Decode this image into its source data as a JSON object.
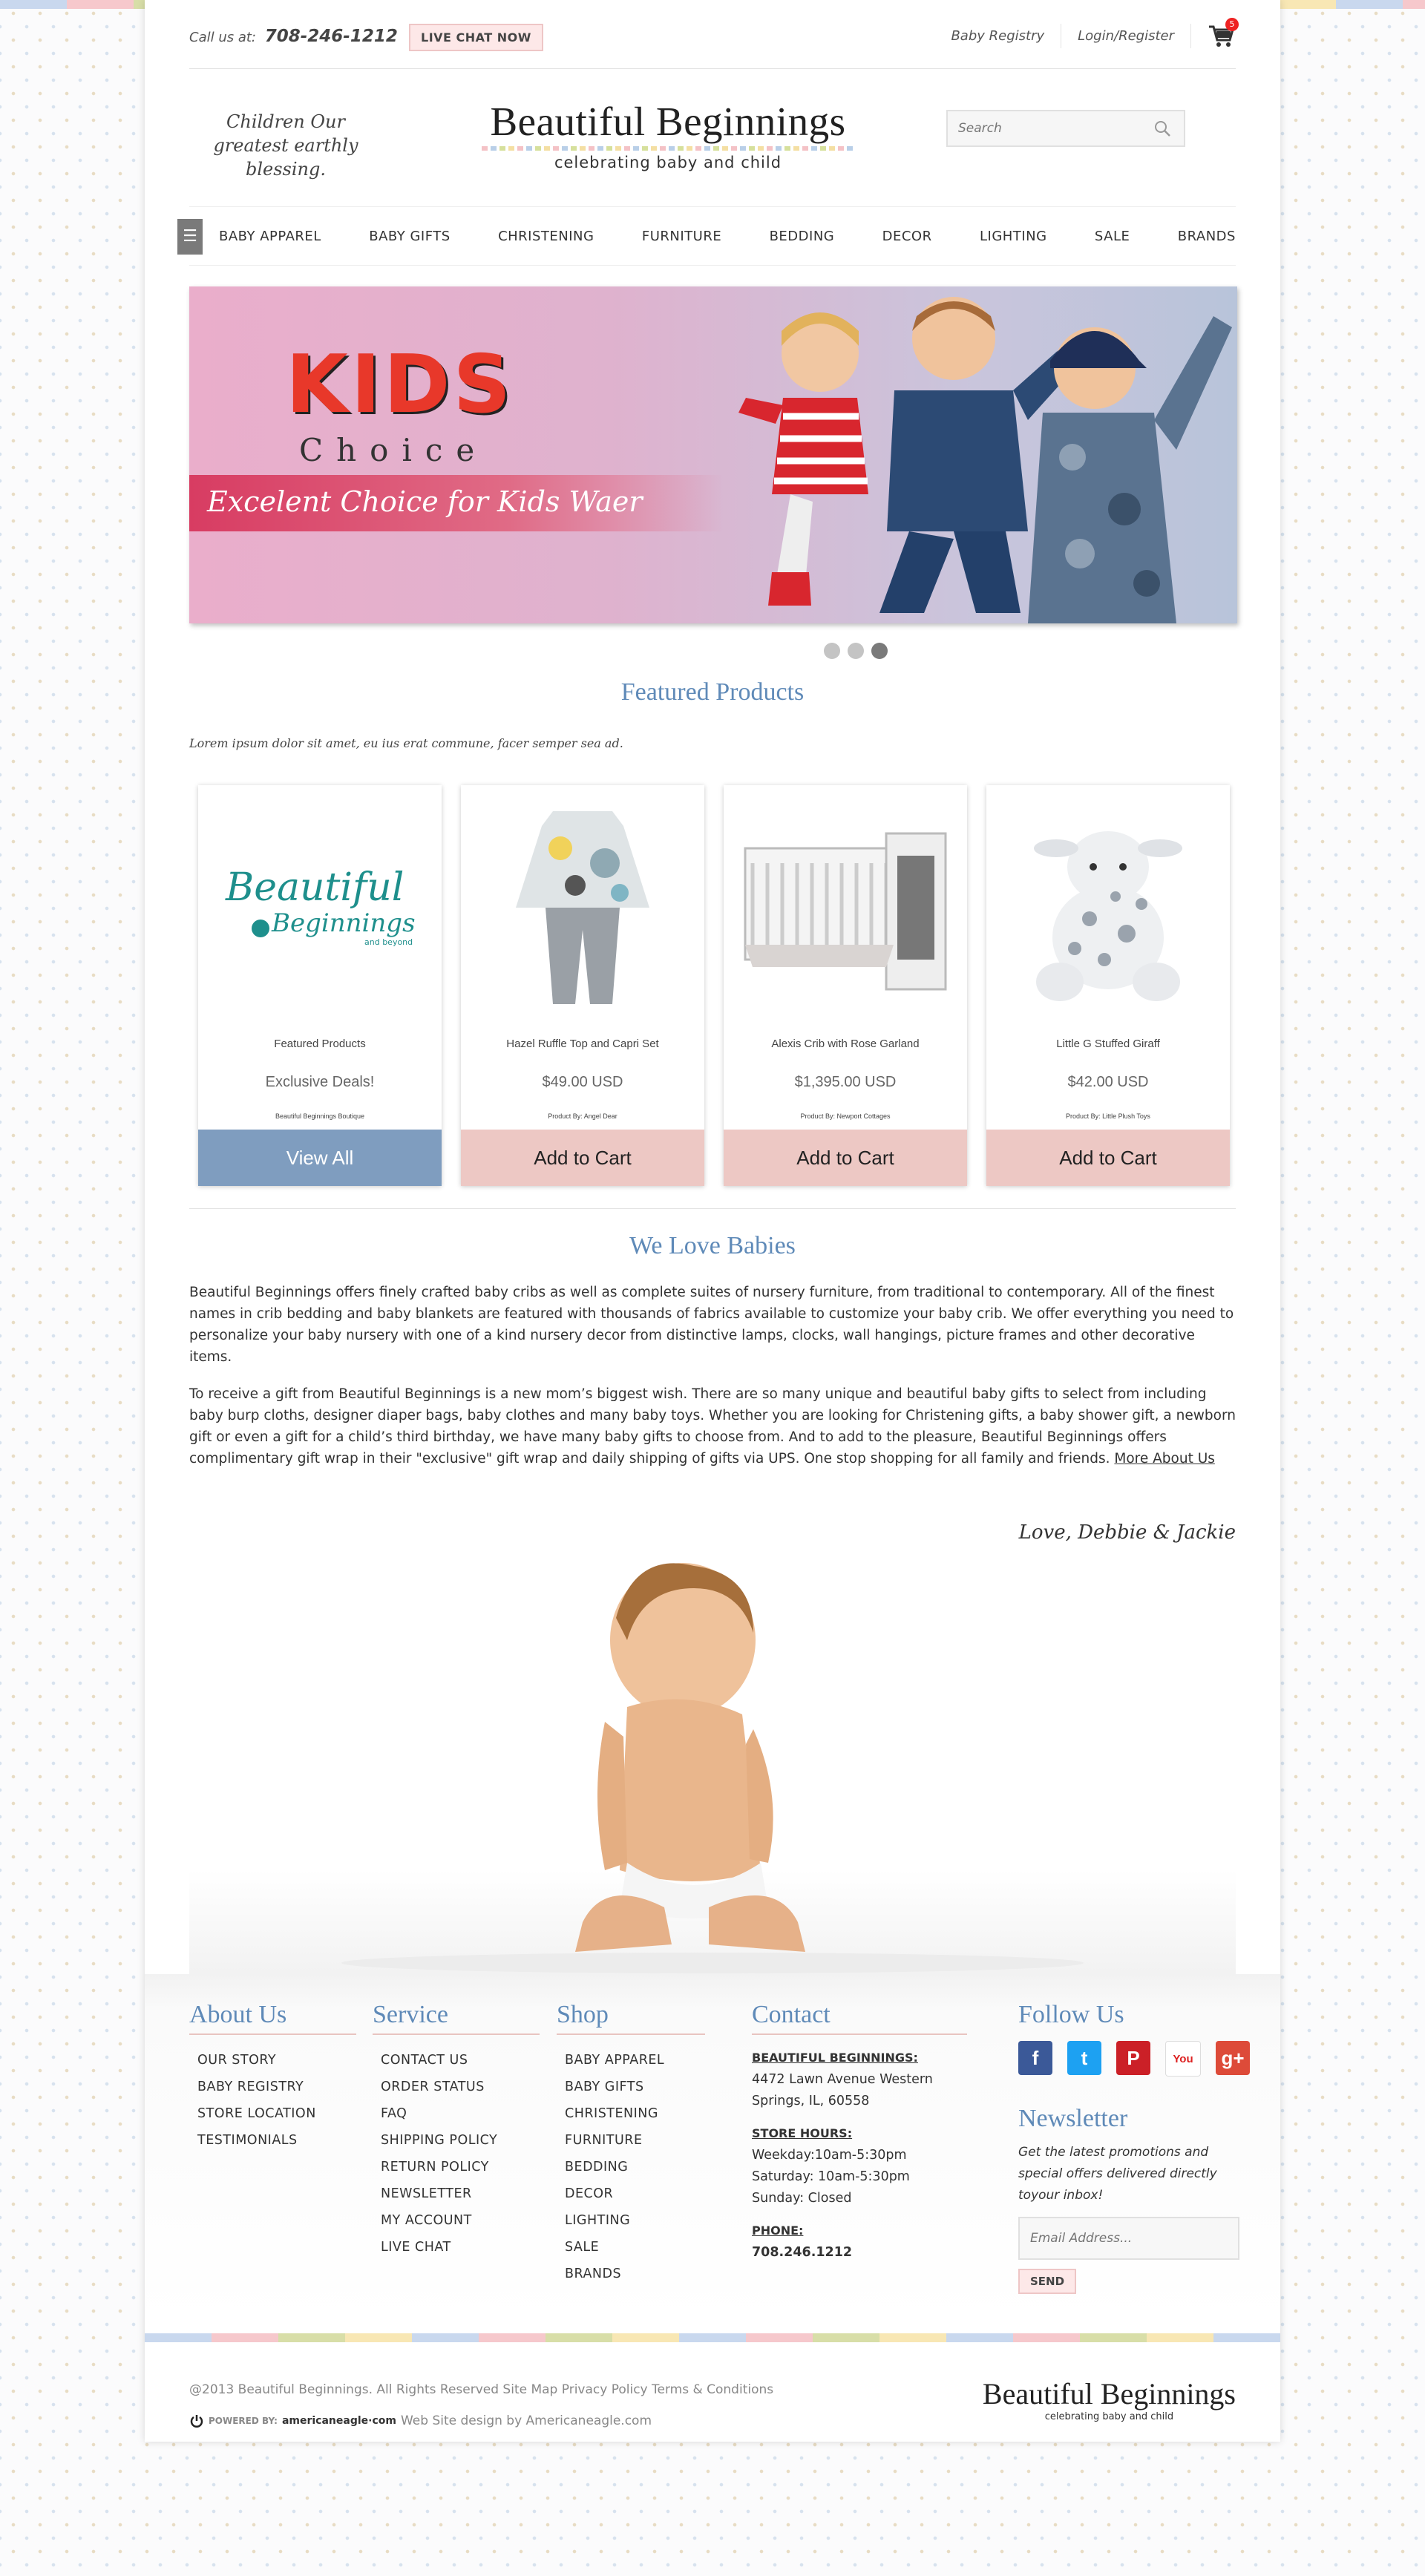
{
  "topbar": {
    "call_label": "Call us at:",
    "phone": "708-246-1212",
    "live_chat": "LIVE CHAT NOW",
    "links": [
      "Baby Registry",
      "Login/Register"
    ],
    "cart_count": "5"
  },
  "header": {
    "tagline": "Children Our greatest earthly blessing.",
    "logo_name": "Beautiful Beginnings",
    "logo_sub": "celebrating baby and child",
    "search_placeholder": "Search"
  },
  "nav": {
    "items": [
      "BABY APPAREL",
      "BABY GIFTS",
      "CHRISTENING",
      "FURNITURE",
      "BEDDING",
      "DECOR",
      "LIGHTING",
      "SALE",
      "BRANDS"
    ]
  },
  "banner": {
    "kids_word": "KIDS",
    "choice_word": "Choice",
    "slogan": "Excelent Choice for Kids Waer",
    "active_slide": 3
  },
  "featured": {
    "title": "Featured Products",
    "intro": "Lorem ipsum dolor sit amet, eu ius erat commune, facer semper sea ad.",
    "products": [
      {
        "name": "Featured Products",
        "price": "Exclusive Deals!",
        "by": "Beautiful Beginnings Boutique",
        "cta": "View All",
        "logo_text": "Beautiful",
        "logo_text2": "Beginnings",
        "logo_text3": "and beyond"
      },
      {
        "name": "Hazel Ruffle Top and Capri Set",
        "price": "$49.00 USD",
        "by": "Product By: Angel Dear",
        "cta": "Add to Cart"
      },
      {
        "name": "Alexis Crib with Rose Garland",
        "price": "$1,395.00 USD",
        "by": "Product By: Newport Cottages",
        "cta": "Add to Cart"
      },
      {
        "name": "Little G Stuffed Giraff",
        "price": "$42.00 USD",
        "by": "Product By: Little Plush Toys",
        "cta": "Add to Cart"
      }
    ]
  },
  "about": {
    "title": "We Love Babies",
    "p1": "Beautiful Beginnings offers finely crafted baby cribs as well as complete suites of nursery furniture, from traditional to contemporary. All of the finest names in crib bedding and baby blankets are featured with thousands of fabrics available to customize your baby crib. We offer everything you need to personalize your baby nursery with one of a kind nursery decor from distinctive lamps, clocks, wall hangings, picture frames and other decorative items.",
    "p2": "To receive a gift from Beautiful Beginnings is a new mom’s biggest wish. There are so many unique and beautiful baby gifts to select from including baby burp cloths, designer diaper bags, baby clothes and many baby toys. Whether you are looking for Christening gifts, a baby shower gift, a newborn gift or even a gift for a child’s third birthday, we have many baby gifts to choose from. And to add to the pleasure, Beautiful Beginnings offers complimentary gift wrap in their \"exclusive\" gift wrap and daily shipping of gifts via UPS. One stop shopping for all family and friends.",
    "more_link": "More About Us",
    "signoff": "Love, Debbie & Jackie"
  },
  "footer": {
    "about": {
      "title": "About Us",
      "items": [
        "OUR STORY",
        "BABY REGISTRY",
        "STORE LOCATION",
        "TESTIMONIALS"
      ]
    },
    "service": {
      "title": "Service",
      "items": [
        "CONTACT US",
        "ORDER STATUS",
        "FAQ",
        "SHIPPING POLICY",
        "RETURN POLICY",
        "NEWSLETTER",
        "MY ACCOUNT",
        "LIVE CHAT"
      ]
    },
    "shop": {
      "title": "Shop",
      "items": [
        "BABY APPAREL",
        "BABY GIFTS",
        "CHRISTENING",
        "FURNITURE",
        "BEDDING",
        "DECOR",
        "LIGHTING",
        "SALE",
        "BRANDS"
      ]
    },
    "contact": {
      "title": "Contact",
      "store_label": "BEAUTIFUL BEGINNINGS:",
      "address1": "4472 Lawn Avenue Western",
      "address2": "Springs, IL, 60558",
      "hours_label": "STORE HOURS:",
      "hours1": "Weekday:10am-5:30pm",
      "hours2": "Saturday: 10am-5:30pm",
      "hours3": "Sunday: Closed",
      "phone_label": "PHONE:",
      "phone": "708.246.1212"
    },
    "follow": {
      "title": "Follow Us",
      "icons": [
        "facebook-icon",
        "twitter-icon",
        "pinterest-icon",
        "youtube-icon",
        "google-plus-icon"
      ],
      "fb": "f",
      "tw": "t",
      "pin": "P",
      "yt": "You",
      "gp": "g+"
    },
    "newsletter": {
      "title": "Newsletter",
      "text": "Get the latest promotions and special offers delivered directly toyour inbox!",
      "placeholder": "Email Address...",
      "send": "SEND"
    }
  },
  "bottom": {
    "copyright": "@2013 Beautiful Beginnings. All Rights Reserved Site Map Privacy Policy Terms & Conditions",
    "powered_label": "POWERED BY:",
    "powered_brand": "americaneagle·com",
    "design": "Web Site design by Americaneagle.com",
    "logo_name": "Beautiful Beginnings",
    "logo_sub": "celebrating baby and child"
  },
  "colors": {
    "accent_blue": "#5f8ab8",
    "pink_button": "#edc8c4",
    "view_all": "#7f9dbf",
    "cart_badge": "#e22222"
  }
}
